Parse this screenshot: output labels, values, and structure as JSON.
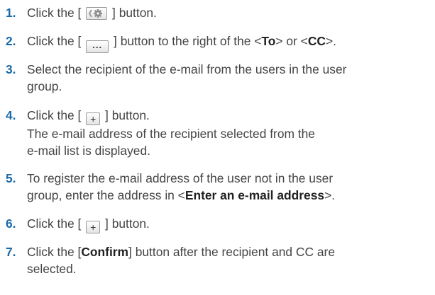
{
  "steps": [
    {
      "number": "1.",
      "before": "Click the [",
      "button": "gear-icon",
      "after": "] button."
    },
    {
      "number": "2.",
      "before": "Click the [",
      "button": "more-icon",
      "button_text": "...",
      "after": "] button to the right of the <",
      "to": "To",
      "mid": "> or <",
      "cc": "CC",
      "end": ">."
    },
    {
      "number": "3.",
      "line1": "Select the recipient of the e-mail from the users in the user",
      "line2": "group."
    },
    {
      "number": "4.",
      "before": "Click the [",
      "button": "plus-icon",
      "button_text": "+",
      "after": "] button.",
      "line2": "The e-mail address of the recipient selected from the",
      "line3": "e-mail list is displayed."
    },
    {
      "number": "5.",
      "line1": "To register the e-mail address of the user not in the user",
      "line2_before": "group, enter the address in <",
      "line2_bold": "Enter an e-mail address",
      "line2_after": ">."
    },
    {
      "number": "6.",
      "before": "Click the [",
      "button": "plus-icon",
      "button_text": "+",
      "after": "] button."
    },
    {
      "number": "7.",
      "before": "Click the [",
      "bold": "Confirm",
      "after": "] button after the recipient and CC are",
      "line2": "selected."
    }
  ],
  "colors": {
    "number": "#1a6aa8",
    "text": "#444444"
  }
}
